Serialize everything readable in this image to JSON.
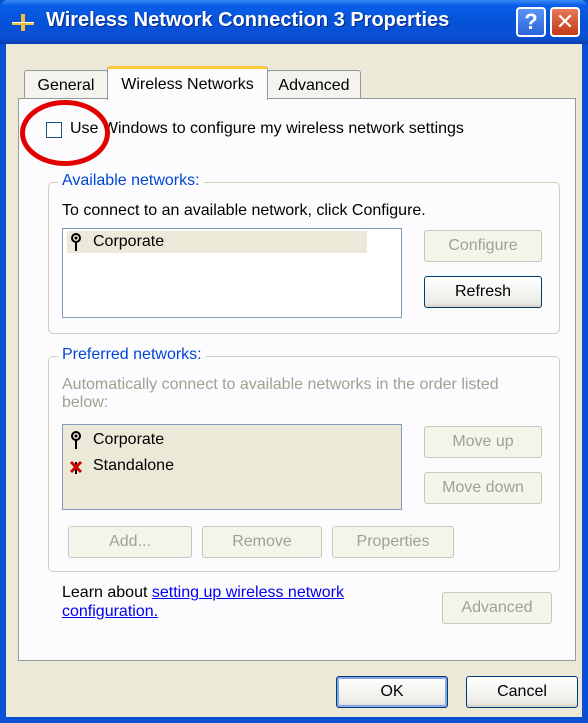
{
  "window": {
    "title": "Wireless Network Connection 3 Properties",
    "help_glyph": "?",
    "close_glyph": "✕"
  },
  "tabs": [
    {
      "label": "General",
      "active": false
    },
    {
      "label": "Wireless Networks",
      "active": true
    },
    {
      "label": "Advanced",
      "active": false
    }
  ],
  "use_windows": {
    "label": "Use Windows to configure my wireless network settings",
    "checked": false
  },
  "available": {
    "group_title": "Available networks:",
    "instruction": "To connect to an available network, click Configure.",
    "networks": [
      {
        "name": "Corporate",
        "icon": "antenna-icon"
      }
    ],
    "configure_label": "Configure",
    "refresh_label": "Refresh"
  },
  "preferred": {
    "group_title": "Preferred networks:",
    "instruction_line1": "Automatically connect to available networks in the order listed",
    "instruction_line2": "below:",
    "networks": [
      {
        "name": "Corporate",
        "icon": "antenna-icon"
      },
      {
        "name": "Standalone",
        "icon": "adhoc-icon"
      }
    ],
    "move_up_label": "Move up",
    "move_down_label": "Move down",
    "add_label": "Add...",
    "remove_label": "Remove",
    "properties_label": "Properties"
  },
  "learn": {
    "prefix": "Learn about ",
    "link_line1": "setting up wireless network",
    "link_line2": "configuration.",
    "advanced_label": "Advanced"
  },
  "footer": {
    "ok_label": "OK",
    "cancel_label": "Cancel"
  },
  "colors": {
    "titlebar": "#0a4fd4",
    "dialog_bg": "#ece9d8",
    "annotation_circle": "#e20000"
  }
}
